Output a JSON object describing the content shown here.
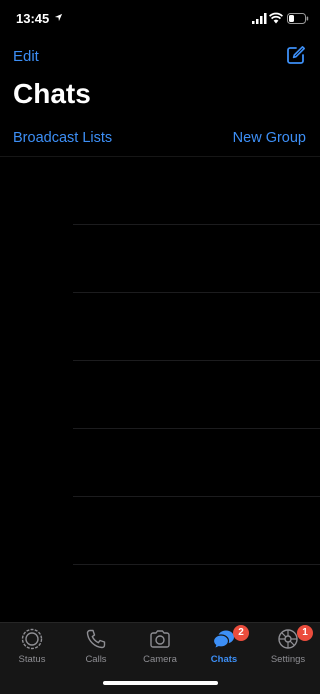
{
  "status_bar": {
    "time": "13:45",
    "icons": [
      "location-arrow-icon",
      "signal-icon",
      "wifi-icon",
      "battery-icon"
    ]
  },
  "nav": {
    "edit_label": "Edit",
    "compose_icon": "compose-icon"
  },
  "page_title": "Chats",
  "actions": {
    "broadcast_label": "Broadcast Lists",
    "new_group_label": "New Group"
  },
  "chat_rows": 6,
  "tabs": [
    {
      "label": "Status",
      "icon": "status-icon",
      "active": false
    },
    {
      "label": "Calls",
      "icon": "phone-icon",
      "active": false
    },
    {
      "label": "Camera",
      "icon": "camera-icon",
      "active": false
    },
    {
      "label": "Chats",
      "icon": "chats-icon",
      "active": true,
      "badge": "2"
    },
    {
      "label": "Settings",
      "icon": "settings-gear-icon",
      "active": false,
      "badge": "1"
    }
  ],
  "colors": {
    "accent": "#3d8ff6",
    "background": "#000000",
    "tab_bar": "#161616",
    "badge": "#eb4d3d",
    "inactive": "#8e8e93"
  }
}
